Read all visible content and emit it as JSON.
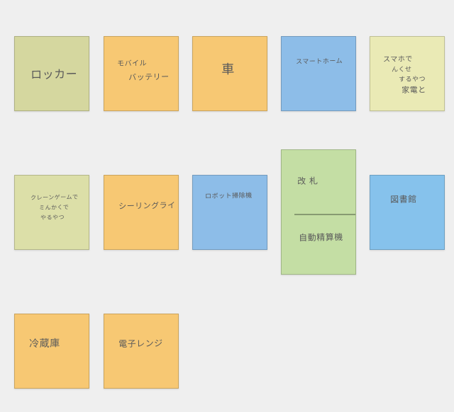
{
  "colors": {
    "background": "#efefef",
    "olive": "#d5d79f",
    "orange": "#f7c873",
    "blue": "#8dbde8",
    "pale_yellow": "#eaeab5",
    "pale_olive": "#dcdfa8",
    "green": "#c4dea4",
    "sky": "#86c2ec",
    "text": "#5a5a5a"
  },
  "notes": [
    {
      "id": "locker",
      "lines": [
        "ロッカー"
      ]
    },
    {
      "id": "mobile-battery",
      "lines": [
        "モバイル",
        "バッテリー"
      ]
    },
    {
      "id": "car",
      "lines": [
        "車"
      ]
    },
    {
      "id": "smart-home",
      "lines": [
        "スマートホーム"
      ]
    },
    {
      "id": "smartphone-appliance",
      "lines": [
        "スマホで",
        "んくせ",
        "するやつ",
        "家電と"
      ]
    },
    {
      "id": "crane-game",
      "lines": [
        "クレーンゲームで",
        "ミんかくで",
        "やるやつ"
      ]
    },
    {
      "id": "ceiling-light",
      "lines": [
        "シーリングライト"
      ]
    },
    {
      "id": "robot-vacuum",
      "lines": [
        "ロボット掃除機"
      ]
    },
    {
      "id": "fare-machine",
      "top": "改 札",
      "bottom": "自動精算機"
    },
    {
      "id": "library",
      "lines": [
        "図書館"
      ]
    },
    {
      "id": "refrigerator",
      "lines": [
        "冷蔵庫"
      ]
    },
    {
      "id": "microwave",
      "lines": [
        "電子レンジ"
      ]
    }
  ]
}
